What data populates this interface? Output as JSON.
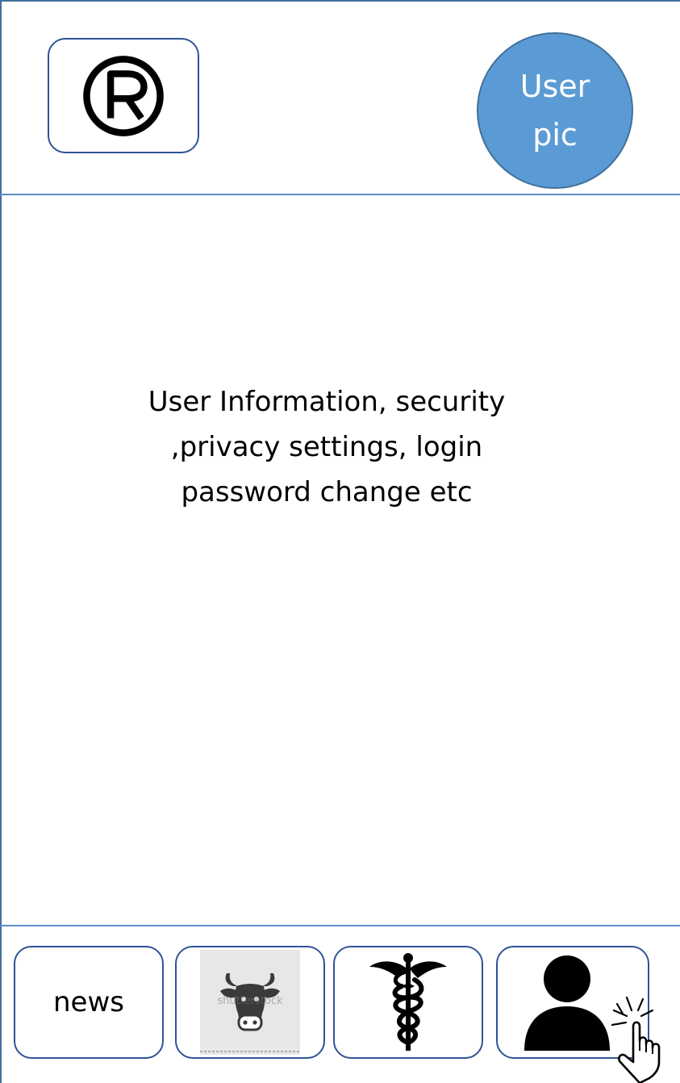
{
  "header": {
    "logo_icon": "registered-trademark-icon",
    "avatar": {
      "line1": "User",
      "line2": "pic"
    }
  },
  "main": {
    "lines": [
      "User Information, security",
      ",privacy settings, login",
      "password change etc"
    ]
  },
  "bottom_nav": {
    "items": [
      {
        "label": "news"
      },
      {
        "icon": "cow-icon",
        "watermark": "shutterstock"
      },
      {
        "icon": "caduceus-icon"
      },
      {
        "icon": "user-profile-icon"
      }
    ],
    "cursor_icon": "pointing-hand-cursor-icon"
  },
  "colors": {
    "accent": "#5b9bd5",
    "border": "#2f5496",
    "divider": "#5b8ec6"
  }
}
